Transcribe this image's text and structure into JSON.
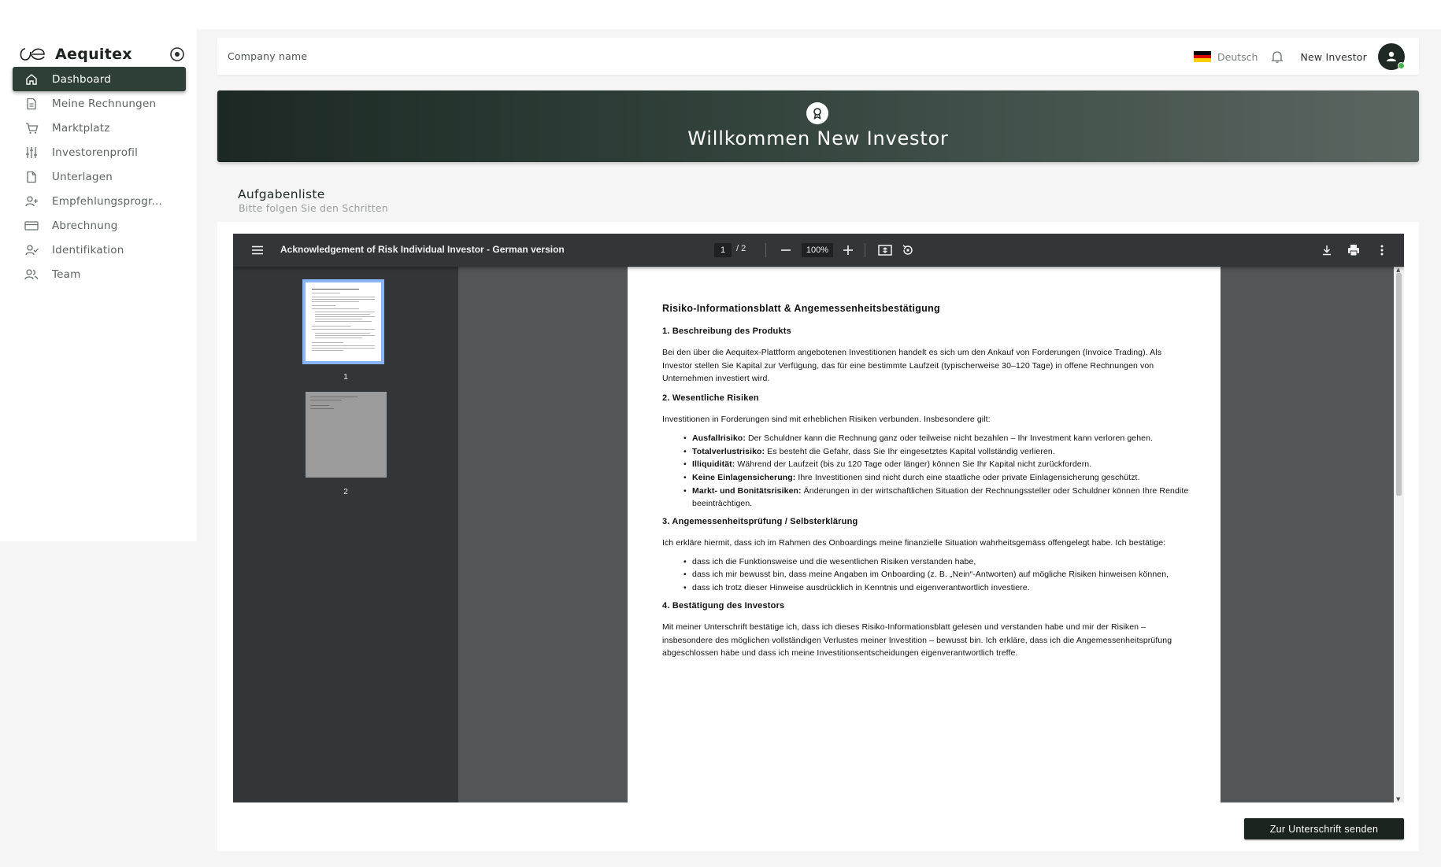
{
  "brand": {
    "name": "Aequitex"
  },
  "sidebar": {
    "items": [
      {
        "label": "Dashboard",
        "icon": "home-icon",
        "active": true
      },
      {
        "label": "Meine Rechnungen",
        "icon": "invoice-icon"
      },
      {
        "label": "Marktplatz",
        "icon": "cart-icon"
      },
      {
        "label": "Investorenprofil",
        "icon": "sliders-icon"
      },
      {
        "label": "Unterlagen",
        "icon": "document-icon"
      },
      {
        "label": "Empfehlungsprogr...",
        "icon": "user-plus-icon"
      },
      {
        "label": "Abrechnung",
        "icon": "credit-card-icon"
      },
      {
        "label": "Identifikation",
        "icon": "user-check-icon"
      },
      {
        "label": "Team",
        "icon": "users-icon"
      }
    ]
  },
  "header": {
    "company": "Company name",
    "language": "Deutsch",
    "user_name": "New Investor"
  },
  "banner": {
    "title": "Willkommen New Investor"
  },
  "tasks": {
    "title": "Aufgabenliste",
    "subtitle": "Bitte folgen Sie den Schritten"
  },
  "viewer": {
    "doc_title": "Acknowledgement of Risk Individual Investor - German version",
    "current_page": "1",
    "total_pages": "/  2",
    "zoom": "100%",
    "thumb_labels": [
      "1",
      "2"
    ]
  },
  "document": {
    "title": "Risiko-Informationsblatt & Angemessenheitsbestätigung",
    "s1_heading": "1. Beschreibung des Produkts",
    "s1_text": "Bei den über die Aequitex-Plattform angebotenen Investitionen handelt es sich um den Ankauf von Forderungen (Invoice Trading). Als Investor stellen Sie Kapital zur Verfügung, das für eine bestimmte Laufzeit (typischerweise 30–120 Tage) in offene Rechnungen von Unternehmen investiert wird.",
    "s2_heading": "2. Wesentliche Risiken",
    "s2_intro": "Investitionen in Forderungen sind mit erheblichen Risiken verbunden. Insbesondere gilt:",
    "risks": [
      {
        "term": "Ausfallrisiko:",
        "text": " Der Schuldner kann die Rechnung ganz oder teilweise nicht bezahlen – Ihr Investment kann verloren gehen."
      },
      {
        "term": "Totalverlustrisiko:",
        "text": " Es besteht die Gefahr, dass Sie Ihr eingesetztes Kapital vollständig verlieren."
      },
      {
        "term": "Illiquidität:",
        "text": " Während der Laufzeit (bis zu 120 Tage oder länger) können Sie Ihr Kapital nicht zurückfordern."
      },
      {
        "term": "Keine Einlagensicherung:",
        "text": " Ihre Investitionen sind nicht durch eine staatliche oder private Einlagensicherung geschützt."
      },
      {
        "term": "Markt- und Bonitätsrisiken:",
        "text": " Änderungen in der wirtschaftlichen Situation der Rechnungssteller oder Schuldner können Ihre Rendite beeinträchtigen."
      }
    ],
    "s3_heading": "3. Angemessenheitsprüfung / Selbsterklärung",
    "s3_intro": "Ich erkläre hiermit, dass ich im Rahmen des Onboardings meine finanzielle Situation wahrheitsgemäss offengelegt habe. Ich bestätige:",
    "confirmations": [
      "dass ich die Funktionsweise und die wesentlichen Risiken verstanden habe,",
      "dass ich mir bewusst bin, dass meine Angaben im Onboarding (z. B. „Nein“-Antworten) auf mögliche Risiken hinweisen können,",
      "dass ich trotz dieser Hinweise ausdrücklich in Kenntnis und eigenverantwortlich investiere."
    ],
    "s4_heading": "4. Bestätigung des Investors",
    "s4_text": "Mit meiner Unterschrift bestätige ich, dass ich dieses Risiko-Informationsblatt gelesen und verstanden habe und mir der Risiken – insbesondere des möglichen vollständigen Verlustes meiner Investition – bewusst bin. Ich erkläre, dass ich die Angemessenheitsprüfung abgeschlossen habe und dass ich meine Investitionsentscheidungen eigenverantwortlich treffe."
  },
  "actions": {
    "submit_label": "Zur Unterschrift senden"
  },
  "colors": {
    "accent": "#2d3f37",
    "sidebar_active": "#2d3f37",
    "online": "#4caf50",
    "viewer_toolbar": "#323639"
  }
}
